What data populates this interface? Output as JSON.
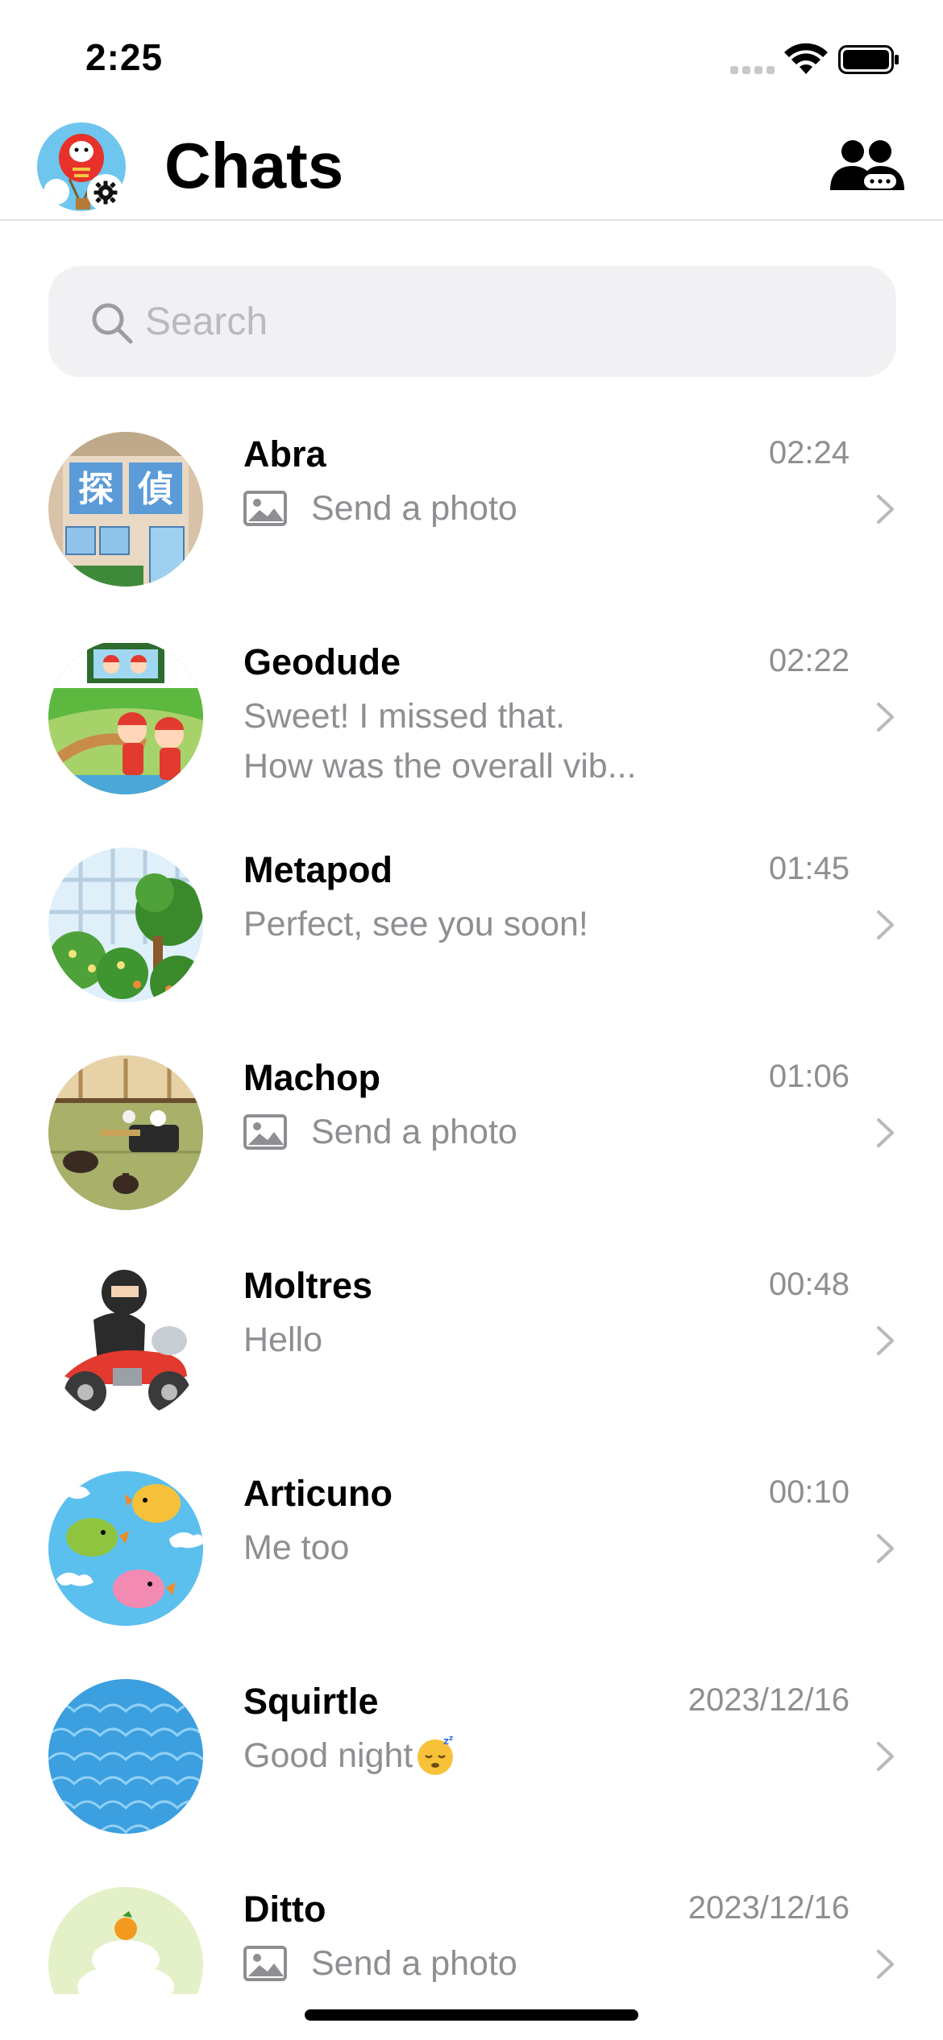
{
  "status_bar": {
    "time": "2:25"
  },
  "header": {
    "title": "Chats"
  },
  "search": {
    "placeholder": "Search"
  },
  "chats": [
    {
      "name": "Abra",
      "time": "02:24",
      "preview": "Send a photo",
      "preview_type": "photo",
      "avatar": "detective-building-avatar"
    },
    {
      "name": "Geodude",
      "time": "02:22",
      "preview_line1": "Sweet! I missed that.",
      "preview_line2": "How was the overall vib...",
      "avatar": "baseball-fans-avatar"
    },
    {
      "name": "Metapod",
      "time": "01:45",
      "preview": "Perfect, see you soon!",
      "avatar": "greenhouse-avatar"
    },
    {
      "name": "Machop",
      "time": "01:06",
      "preview": "Send a photo",
      "preview_type": "photo",
      "avatar": "tea-ceremony-avatar"
    },
    {
      "name": "Moltres",
      "time": "00:48",
      "preview": "Hello",
      "avatar": "ninja-motorcycle-avatar"
    },
    {
      "name": "Articuno",
      "time": "00:10",
      "preview": "Me too",
      "avatar": "birds-pattern-avatar"
    },
    {
      "name": "Squirtle",
      "time": "2023/12/16",
      "preview": "Good night",
      "preview_emoji": "sleeping-face-emoji",
      "avatar": "wave-pattern-avatar"
    },
    {
      "name": "Ditto",
      "time": "2023/12/16",
      "preview": "Send a photo",
      "preview_type": "photo",
      "avatar": "kagami-mochi-avatar"
    }
  ],
  "colors": {
    "secondary_text": "#8e8e93",
    "search_bg": "#f1f1f4",
    "divider": "#e3e3e6"
  }
}
